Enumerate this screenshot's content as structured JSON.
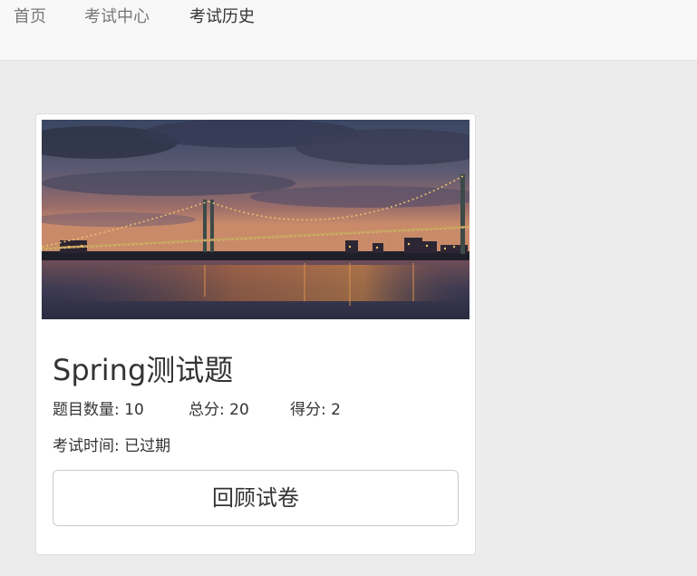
{
  "nav": {
    "items": [
      {
        "label": "首页"
      },
      {
        "label": "考试中心"
      },
      {
        "label": "考试历史"
      }
    ]
  },
  "card": {
    "image": "bridge-night-photo",
    "title": "Spring测试题",
    "question_count": "题目数量: 10",
    "total_score": "总分: 20",
    "score": "得分: 2",
    "exam_time": "考试时间: 已过期",
    "review_button": "回顾试卷"
  },
  "colors": {
    "page_bg": "#ececec",
    "navbar_bg": "#f8f8f8",
    "card_bg": "#ffffff",
    "text": "#333333",
    "nav_text": "#777777"
  }
}
